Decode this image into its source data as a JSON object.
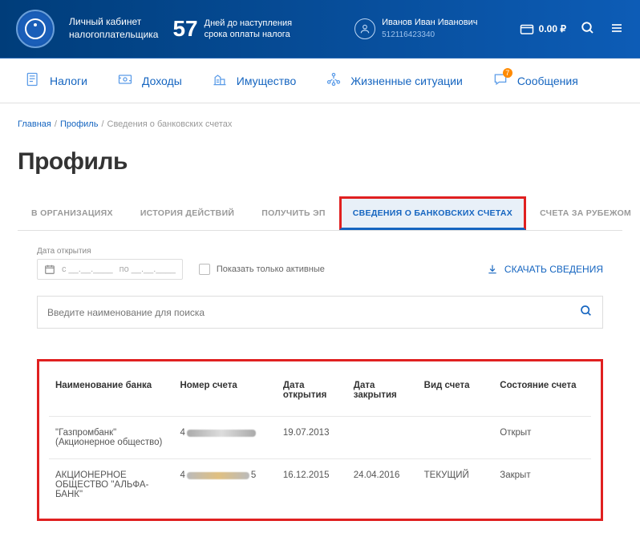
{
  "header": {
    "cabinet_line1": "Личный кабинет",
    "cabinet_line2": "налогоплательщика",
    "countdown_num": "57",
    "countdown_line1": "Дней до наступления",
    "countdown_line2": "срока оплаты налога",
    "user_name": "Иванов Иван Иванович",
    "user_id": "512116423340",
    "balance": "0.00 ₽"
  },
  "nav": {
    "taxes": "Налоги",
    "income": "Доходы",
    "property": "Имущество",
    "situations": "Жизненные ситуации",
    "messages": "Сообщения",
    "messages_badge": "7"
  },
  "breadcrumb": {
    "home": "Главная",
    "profile": "Профиль",
    "current": "Сведения о банковских счетах"
  },
  "page_title": "Профиль",
  "tabs": {
    "orgs": "В ОРГАНИЗАЦИЯХ",
    "history": "ИСТОРИЯ ДЕЙСТВИЙ",
    "get_ep": "ПОЛУЧИТЬ ЭП",
    "bank": "СВЕДЕНИЯ О БАНКОВСКИХ СЧЕТАХ",
    "abroad": "СЧЕТА ЗА РУБЕЖОМ"
  },
  "filters": {
    "date_label": "Дата открытия",
    "date_from": "с __.__.____",
    "date_to": "по __.__.____",
    "active_only": "Показать только активные",
    "download": "СКАЧАТЬ СВЕДЕНИЯ",
    "search_placeholder": "Введите наименование для поиска"
  },
  "table": {
    "headers": {
      "bank": "Наименование банка",
      "account": "Номер счета",
      "open_date": "Дата открытия",
      "close_date": "Дата закрытия",
      "type": "Вид счета",
      "status": "Состояние счета"
    },
    "rows": [
      {
        "bank": "\"Газпромбанк\" (Акционерное общество)",
        "acct_prefix": "4",
        "acct_suffix": "",
        "open_date": "19.07.2013",
        "close_date": "",
        "type": "",
        "status": "Открыт"
      },
      {
        "bank": "АКЦИОНЕРНОЕ ОБЩЕСТВО \"АЛЬФА-БАНК\"",
        "acct_prefix": "4",
        "acct_suffix": "5",
        "open_date": "16.12.2015",
        "close_date": "24.04.2016",
        "type": "ТЕКУЩИЙ",
        "status": "Закрыт"
      }
    ]
  }
}
